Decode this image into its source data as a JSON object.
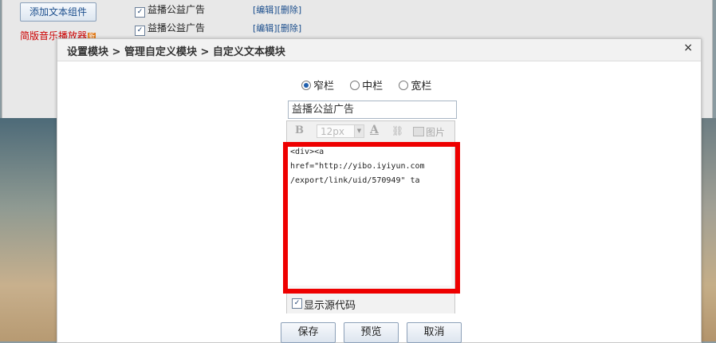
{
  "background": {
    "add_text_widget_label": "添加文本组件",
    "music_player_link": "简版音乐播放器",
    "new_badge": "新",
    "rows": [
      {
        "label": "益播公益广告",
        "checked": "✓",
        "actions": "[编辑][删除]"
      },
      {
        "label": "益播公益广告",
        "checked": "✓",
        "actions": "[编辑][删除]"
      }
    ]
  },
  "dialog": {
    "breadcrumb": "设置模块 > 管理自定义模块 > 自定义文本模块",
    "close_label": "×",
    "width_options": [
      {
        "label": "窄栏",
        "selected": true
      },
      {
        "label": "中栏",
        "selected": false
      },
      {
        "label": "宽栏",
        "selected": false
      }
    ],
    "name_value": "益播公益广告",
    "toolbar": {
      "bold": "B",
      "font_size": "12px",
      "font_color": "A",
      "link": "⛓",
      "image_label": "图片"
    },
    "source_code": "<div><a\nhref=\"http://yibo.iyiyun.com\n/export/link/uid/570949\" ta",
    "show_source_label": "显示源代码",
    "show_source_checked": "✓",
    "buttons": {
      "save": "保存",
      "preview": "预览",
      "cancel": "取消"
    },
    "highlight_color": "#ee0000",
    "accent_color": "#1f5fae"
  }
}
